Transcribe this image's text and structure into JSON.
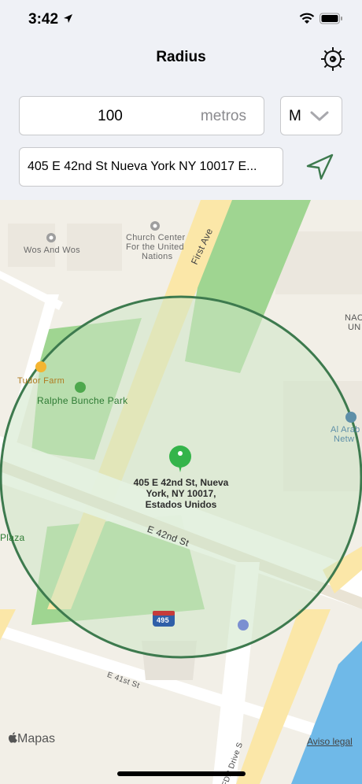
{
  "status": {
    "time": "3:42"
  },
  "nav": {
    "title": "Radius"
  },
  "radius": {
    "value": "100",
    "unit_label": "metros"
  },
  "unit_select": {
    "selected": "M"
  },
  "address": {
    "value": "405 E 42nd St Nueva York NY 10017 E..."
  },
  "map": {
    "pin_label": [
      "405 E 42nd St, Nueva",
      "York, NY  10017,",
      "Estados Unidos"
    ],
    "labels": {
      "wos_and_wos": "Wos And Wos",
      "church_center": [
        "Church Center",
        "For the United",
        "Nations"
      ],
      "first_ave": "First Ave",
      "tudor_farm": "Tudor Farm",
      "ralphe_bunche": "Ralphe Bunche Park",
      "e42": "E 42nd St",
      "e41": "E 41st St",
      "plaza": "Plaza",
      "nac": "NAC",
      "un": "UN",
      "al_arab": "Al Arab",
      "netw": "Netw",
      "fdr": "FDR Drive S",
      "highway": "495"
    },
    "attribution": "Mapas",
    "legal": "Aviso legal"
  },
  "colors": {
    "accent": "#3d7a4e",
    "pin": "#34b44a"
  }
}
